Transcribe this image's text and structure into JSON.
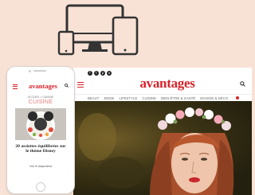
{
  "top_icon": "devices-icon",
  "desktop": {
    "social_icons": [
      "facebook-icon",
      "twitter-icon",
      "pinterest-icon",
      "instagram-icon"
    ],
    "social_glyphs": [
      "f",
      "t",
      "p",
      "o"
    ],
    "menu_icon": "hamburger-icon",
    "logo": "avantages",
    "search_icon": "search-icon",
    "nav_items": [
      "BEAUT",
      "MODE",
      "LIFESTYLE",
      "CUISINE",
      "BIEN-ÊTRE & SANTÉ",
      "MAISON & DÉCO"
    ],
    "hero_image": "woman-flower-crown-photo"
  },
  "phone": {
    "menu_icon": "hamburger-icon",
    "logo": "avantages",
    "search_icon": "search-icon",
    "breadcrumb": "ACCUEIL > CUISINE",
    "section": "CUISINE",
    "image": "disney-themed-plate-photo",
    "title": "20 assiettes équilibrées sur le thème Disney",
    "link": "Voir le diaporama"
  },
  "colors": {
    "background": "#f8e2d6",
    "brand_red": "#d8232a",
    "section_pink": "#e07a7a",
    "device_outline": "#333333"
  }
}
